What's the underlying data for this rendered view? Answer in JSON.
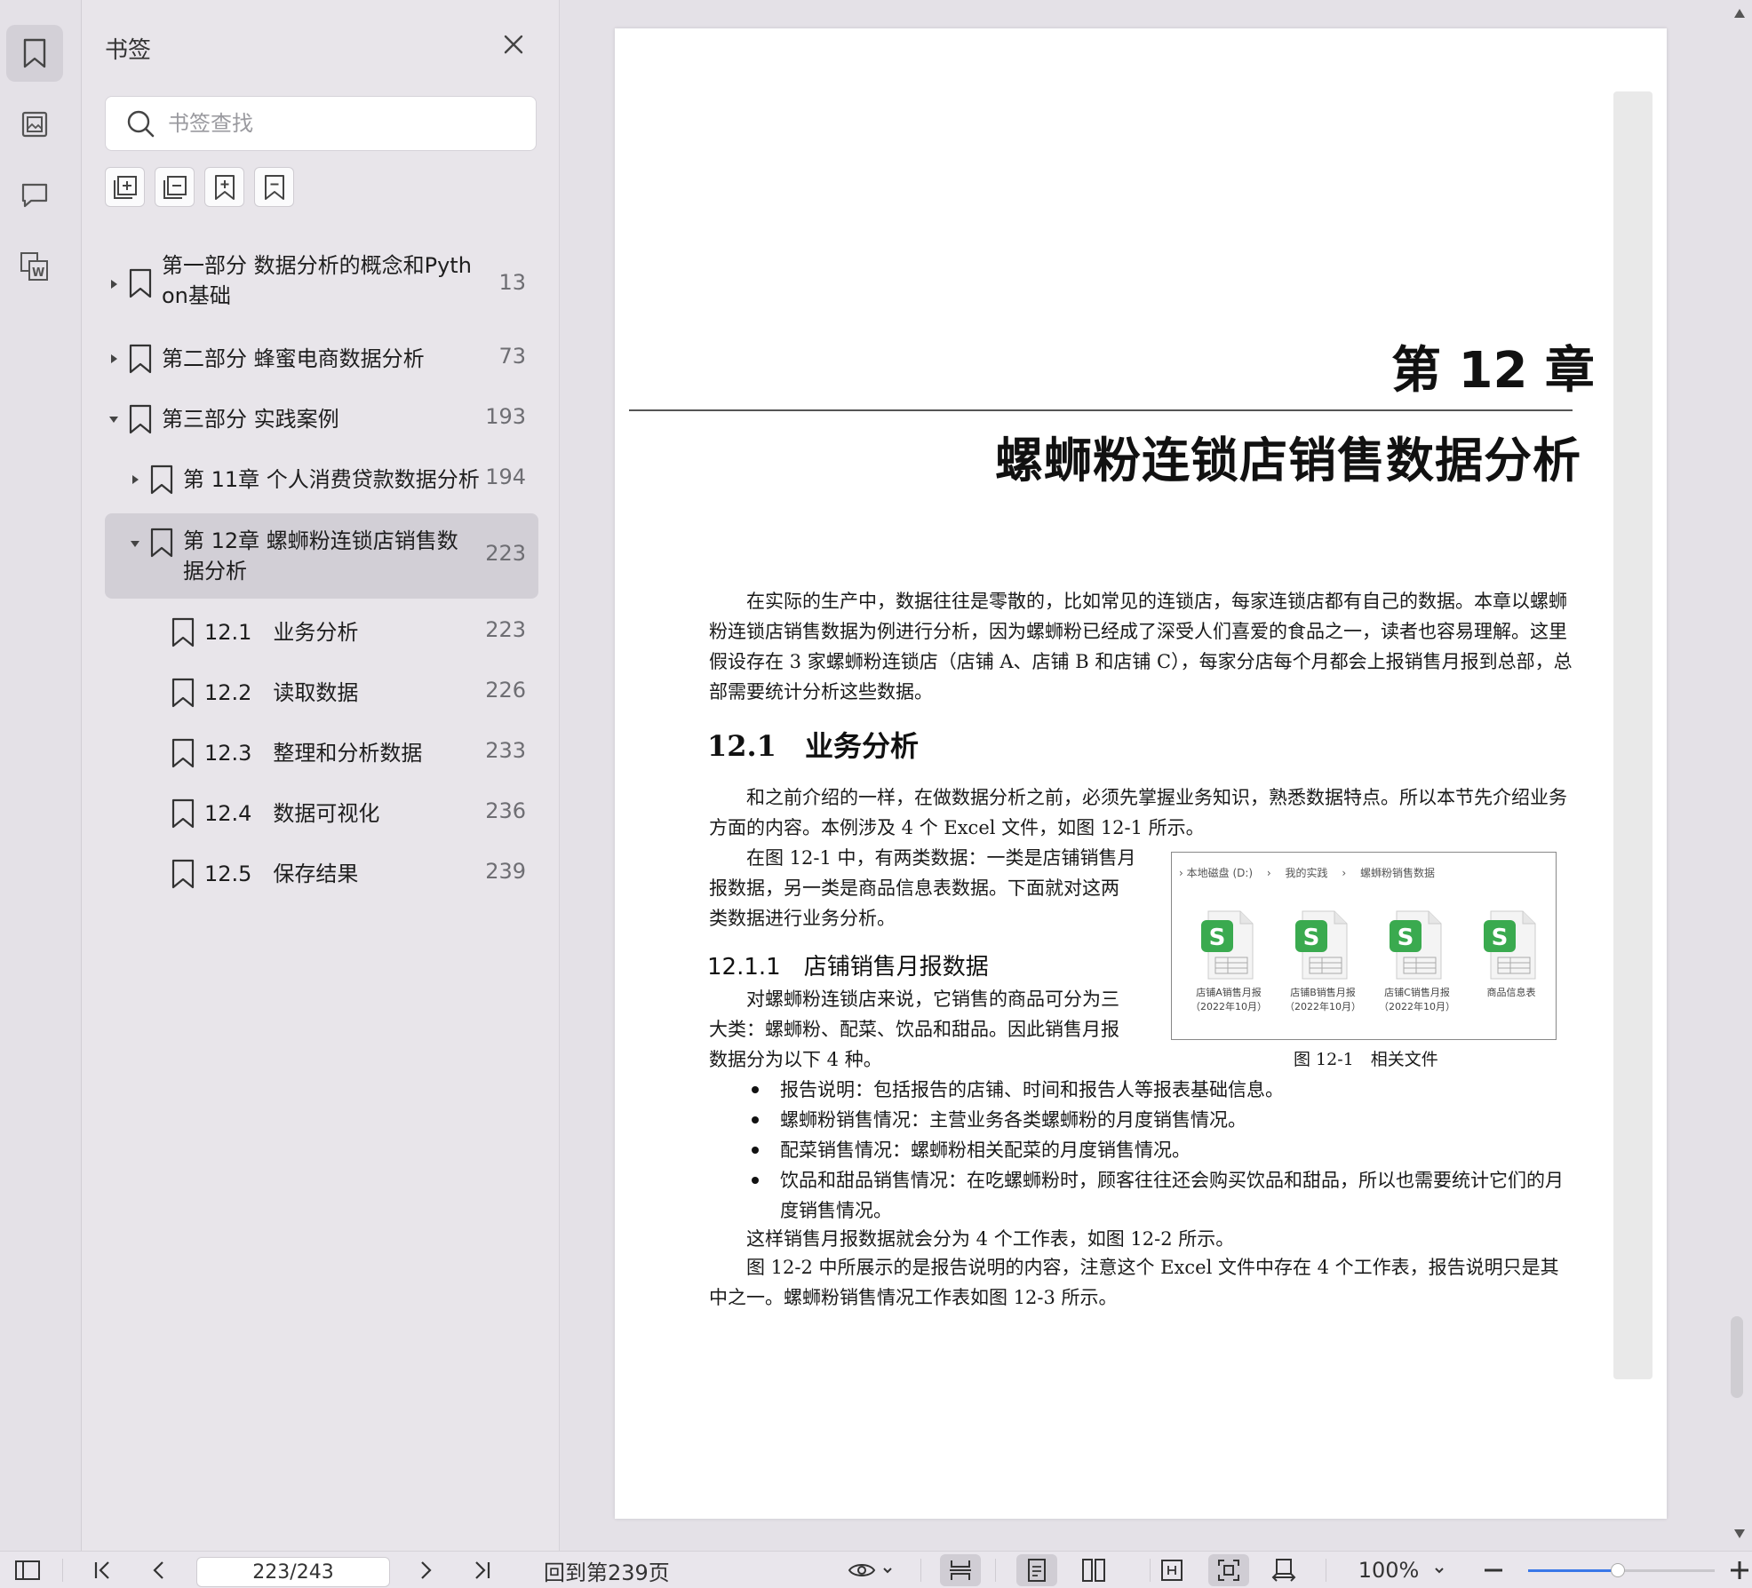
{
  "panel": {
    "title": "书签",
    "search_placeholder": "书签查找"
  },
  "bookmarks": [
    {
      "label": "第一部分 数据分析的概念和Python基础",
      "page": "13",
      "expanded": false
    },
    {
      "label": "第二部分 蜂蜜电商数据分析",
      "page": "73",
      "expanded": false
    },
    {
      "label": "第三部分 实践案例",
      "page": "193",
      "expanded": true
    },
    {
      "label": "第 11章 个人消费贷款数据分析",
      "page": "194",
      "expanded": false
    },
    {
      "label": "第 12章 螺蛳粉连锁店销售数据分析",
      "page": "223",
      "expanded": true,
      "selected": true
    },
    {
      "label": "12.1　业务分析",
      "page": "223"
    },
    {
      "label": "12.2　读取数据",
      "page": "226"
    },
    {
      "label": "12.3　整理和分析数据",
      "page": "233"
    },
    {
      "label": "12.4　数据可视化",
      "page": "236"
    },
    {
      "label": "12.5　保存结果",
      "page": "239"
    }
  ],
  "page": {
    "chapter_number": "第 12 章",
    "chapter_title": "螺蛳粉连锁店销售数据分析",
    "intro": "在实际的生产中，数据往往是零散的，比如常见的连锁店，每家连锁店都有自己的数据。本章以螺蛳粉连锁店销售数据为例进行分析，因为螺蛳粉已经成了深受人们喜爱的食品之一，读者也容易理解。这里假设存在 3 家螺蛳粉连锁店（店铺 A、店铺 B 和店铺 C），每家分店每个月都会上报销售月报到总部，总部需要统计分析这些数据。",
    "section_heading": "12.1　业务分析",
    "section_para": "和之前介绍的一样，在做数据分析之前，必须先掌握业务知识，熟悉数据特点。所以本节先介绍业务方面的内容。本例涉及 4 个 Excel 文件，如图 12-1 所示。",
    "fig_para": "在图 12-1 中，有两类数据：一类是店铺销售月报数据，另一类是商品信息表数据。下面就对这两类数据进行业务分析。",
    "subsection_heading": "12.1.1　店铺销售月报数据",
    "sub_para": "对螺蛳粉连锁店来说，它销售的商品可分为三大类：螺蛳粉、配菜、饮品和甜品。因此销售月报数据分为以下 4 种。",
    "bullets": [
      {
        "term": "报告说明：",
        "text": "包括报告的店铺、时间和报告人等报表基础信息。"
      },
      {
        "term": "螺蛳粉销售情况：",
        "text": "主营业务各类螺蛳粉的月度销售情况。"
      },
      {
        "term": "配菜销售情况：",
        "text": "螺蛳粉相关配菜的月度销售情况。"
      },
      {
        "term": "饮品和甜品销售情况：",
        "text": "在吃螺蛳粉时，顾客往往还会购买饮品和甜品，所以也需要统计它们的月度销售情况。"
      }
    ],
    "para_after1": "这样销售月报数据就会分为 4 个工作表，如图 12-2 所示。",
    "para_after2": "图 12-2 中所展示的是报告说明的内容，注意这个 Excel 文件中存在 4 个工作表，报告说明只是其中之一。螺蛳粉销售情况工作表如图 12-3 所示。",
    "figure": {
      "breadcrumb": [
        "本地磁盘 (D:)",
        "我的实践",
        "螺蛳粉销售数据"
      ],
      "files": [
        {
          "name": "店铺A销售月报（2022年10月）"
        },
        {
          "name": "店铺B销售月报（2022年10月）"
        },
        {
          "name": "店铺C销售月报（2022年10月）"
        },
        {
          "name": "商品信息表"
        }
      ],
      "caption": "图 12-1　相关文件",
      "file_icon_color": "#3aaa4f"
    }
  },
  "bottombar": {
    "page_indicator": "223/243",
    "goto_text": "回到第239页",
    "zoom": "100%",
    "zoom_fraction": 0.48
  },
  "colors": {
    "accent": "#3a78e8",
    "selected_bg": "#d2cfd6"
  }
}
